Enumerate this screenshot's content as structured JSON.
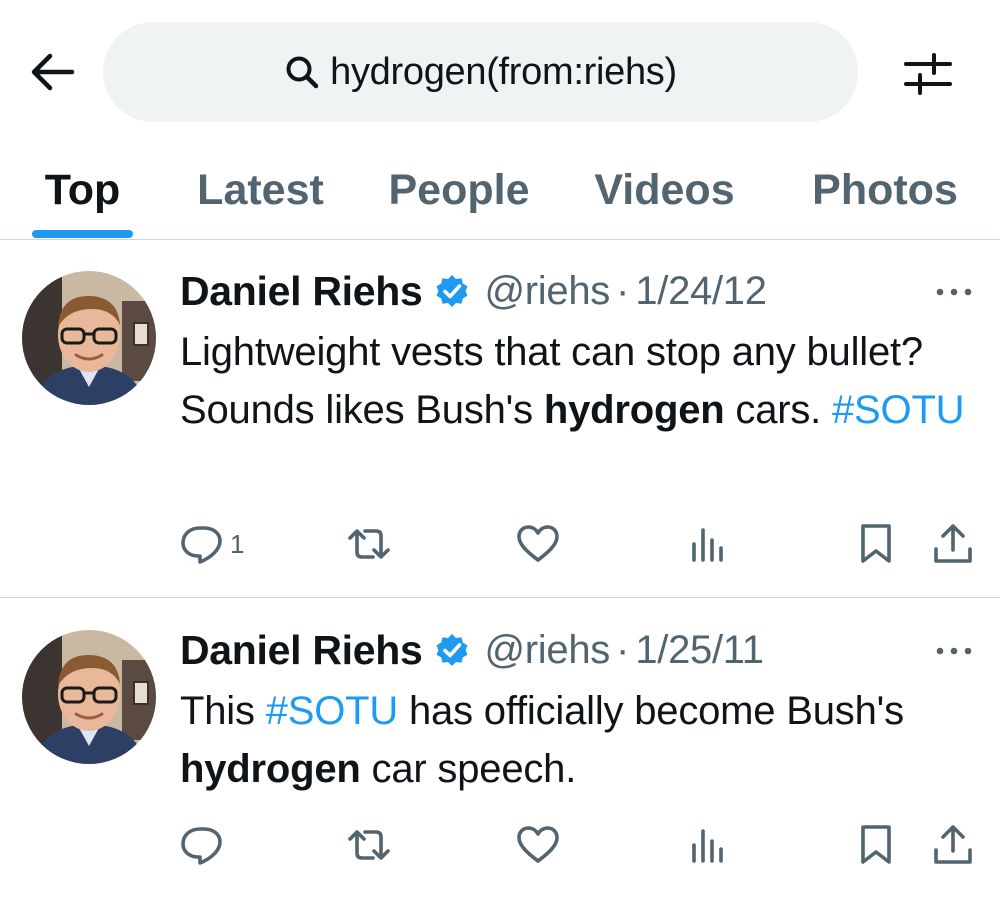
{
  "search": {
    "query": "hydrogen(from:riehs)"
  },
  "tabs": [
    {
      "label": "Top",
      "active": true
    },
    {
      "label": "Latest",
      "active": false
    },
    {
      "label": "People",
      "active": false
    },
    {
      "label": "Videos",
      "active": false
    },
    {
      "label": "Photos",
      "active": false
    }
  ],
  "icons": {
    "back": "arrow-left-icon",
    "search": "magnifier-icon",
    "filter": "sliders-icon",
    "verified": "verified-badge-icon",
    "more": "ellipsis-icon",
    "reply": "reply-icon",
    "retweet": "retweet-icon",
    "like": "heart-icon",
    "views": "bar-chart-icon",
    "bookmark": "bookmark-icon",
    "share": "share-icon"
  },
  "colors": {
    "accent": "#1d9bf0",
    "text": "#0f1419",
    "secondary": "#536471",
    "search_bg": "#eff3f4",
    "divider": "#cfd9de"
  },
  "tweets": [
    {
      "name": "Daniel Riehs",
      "handle": "@riehs",
      "separator": "·",
      "date": "1/24/12",
      "text": {
        "p1": "Lightweight vests that can stop any bullet? Sounds likes Bush's ",
        "highlight": "hydrogen",
        "p2": " cars. ",
        "hashtag": "#SOTU"
      },
      "reply_count": "1"
    },
    {
      "name": "Daniel Riehs",
      "handle": "@riehs",
      "separator": "·",
      "date": "1/25/11",
      "text": {
        "p1": "This ",
        "hashtag": "#SOTU",
        "p2": " has officially become Bush's ",
        "highlight": "hydrogen",
        "p3": " car speech."
      },
      "reply_count": ""
    }
  ]
}
